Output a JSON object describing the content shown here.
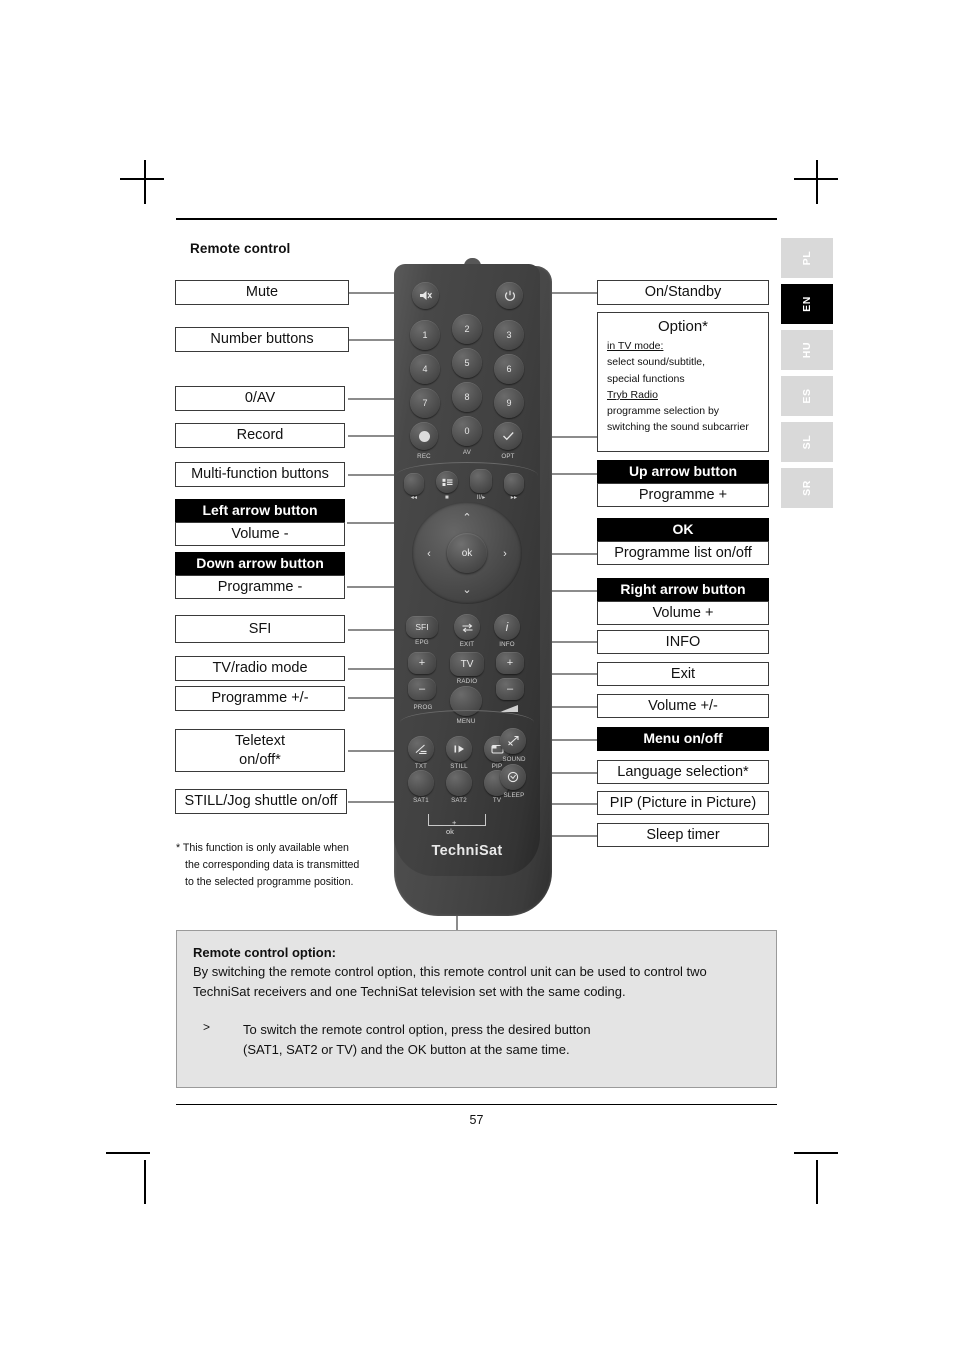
{
  "document": {
    "section_title": "Remote control",
    "page_number": "57"
  },
  "language_tabs": [
    {
      "code": "PL",
      "active": false
    },
    {
      "code": "EN",
      "active": true
    },
    {
      "code": "HU",
      "active": false
    },
    {
      "code": "ES",
      "active": false
    },
    {
      "code": "SL",
      "active": false
    },
    {
      "code": "SR",
      "active": false
    }
  ],
  "left_callouts": {
    "mute": "Mute",
    "number_buttons": "Number buttons",
    "zero_av": "0/AV",
    "record": "Record",
    "multi_function": "Multi-function buttons",
    "left_arrow_header": "Left arrow button",
    "left_arrow_body": "Volume -",
    "down_arrow_header": "Down arrow button",
    "down_arrow_body": "Programme -",
    "sfi": "SFI",
    "tv_radio": "TV/radio mode",
    "programme_plus_minus": "Programme +/-",
    "teletext_line1": "Teletext",
    "teletext_line2": "on/off*",
    "still_jog": "STILL/Jog shuttle on/off"
  },
  "right_callouts": {
    "on_standby": "On/Standby",
    "option_title": "Option*",
    "option_lines": [
      {
        "text": "in TV mode:",
        "underline": true
      },
      {
        "text": "select sound/subtitle,",
        "underline": false
      },
      {
        "text": "special functions",
        "underline": false
      },
      {
        "text": "Tryb Radio",
        "underline": true
      },
      {
        "text": "programme selection by",
        "underline": false
      },
      {
        "text": "switching the sound subcarrier",
        "underline": false
      }
    ],
    "up_arrow_header": "Up arrow button",
    "up_arrow_body": "Programme +",
    "ok_header": "OK",
    "ok_body": "Programme list on/off",
    "right_arrow_header": "Right arrow button",
    "right_arrow_body": "Volume +",
    "info": "INFO",
    "exit": "Exit",
    "volume_plus_minus": "Volume +/-",
    "menu_header": "Menu on/off",
    "language_selection": "Language selection*",
    "pip": "PIP (Picture in Picture)",
    "sleep_timer": "Sleep timer"
  },
  "footnote": {
    "line1": "* This function is only available when",
    "line2": "the corresponding data is transmitted",
    "line3": "to the selected programme position."
  },
  "note": {
    "title": "Remote control option:",
    "paragraph": "By switching the remote control option, this remote control unit can be used to control two TechniSat receivers and one TechniSat television set with the same coding.",
    "bullet_marker": ">",
    "bullet_line1": "To switch the remote control option, press the desired button",
    "bullet_line2": "(SAT1, SAT2 or TV) and the OK button at the same time."
  },
  "remote": {
    "brand": "TechniSat",
    "keys": {
      "mute": "Ð",
      "power": "⏻",
      "n1": "1",
      "n2": "2",
      "n3": "3",
      "n4": "4",
      "n5": "5",
      "n6": "6",
      "n7": "7",
      "n8": "8",
      "n9": "9",
      "n0": "0",
      "rec_cap": "REC",
      "av_cap": "AV",
      "opt_cap": "OPT",
      "opt_glyph": "✓",
      "rew_cap": "◂◂",
      "stop_cap": "■",
      "play_cap": "II/▸",
      "ff_cap": "▸▸",
      "up": "⌃",
      "down": "⌄",
      "left": "‹",
      "right": "›",
      "ok": "ok",
      "sfi": "SFI",
      "epg_cap": "EPG",
      "exit_glyph": "⇄",
      "exit_cap": "EXIT",
      "info": "i",
      "info_cap": "INFO",
      "tv": "TV",
      "radio_cap": "RADIO",
      "prog_plus": "+",
      "prog_minus": "–",
      "prog_cap": "PROG",
      "vol_plus": "+",
      "vol_minus": "–",
      "menu_cap": "MENU",
      "txt_cap": "TXT",
      "still_cap": "STILL",
      "still_glyph": "▸",
      "pip_cap": "PIP",
      "sound_cap": "SOUND",
      "sat1_cap": "SAT1",
      "sat2_cap": "SAT2",
      "tv_cap": "TV",
      "sleep_cap": "SLEEP",
      "ok_bracket_plus": "+",
      "ok_bracket_label": "ok"
    }
  }
}
